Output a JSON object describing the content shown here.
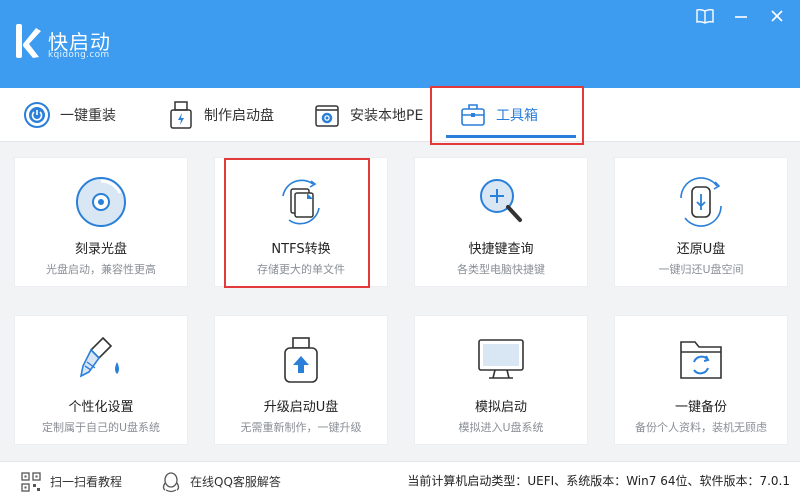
{
  "app": {
    "title": "快启动",
    "url": "kqidong.com"
  },
  "tabs": [
    {
      "label": "一键重装",
      "icon": "power-icon"
    },
    {
      "label": "制作启动盘",
      "icon": "usb-drive-icon"
    },
    {
      "label": "安装本地PE",
      "icon": "gear-box-icon"
    },
    {
      "label": "工具箱",
      "icon": "toolbox-icon",
      "active": true
    }
  ],
  "tools": [
    {
      "title": "刻录光盘",
      "sub": "光盘启动，兼容性更高",
      "icon": "disc-icon"
    },
    {
      "title": "NTFS转换",
      "sub": "存储更大的单文件",
      "icon": "file-convert-icon"
    },
    {
      "title": "快捷键查询",
      "sub": "各类型电脑快捷键",
      "icon": "magnifier-icon"
    },
    {
      "title": "还原U盘",
      "sub": "一键归还U盘空间",
      "icon": "usb-restore-icon"
    },
    {
      "title": "个性化设置",
      "sub": "定制属于自己的U盘系统",
      "icon": "paint-brush-icon"
    },
    {
      "title": "升级启动U盘",
      "sub": "无需重新制作，一键升级",
      "icon": "usb-upgrade-icon"
    },
    {
      "title": "模拟启动",
      "sub": "模拟进入U盘系统",
      "icon": "monitor-icon"
    },
    {
      "title": "一键备份",
      "sub": "备份个人资料，装机无顾虑",
      "icon": "folder-backup-icon"
    }
  ],
  "footer": {
    "qr_label": "扫一扫看教程",
    "qq_label": "在线QQ客服解答",
    "status": "当前计算机启动类型：UEFI、系统版本：Win7 64位、软件版本：7.0.1"
  },
  "colors": {
    "header": "#3d9bf0",
    "accent": "#2a7fd9",
    "highlight": "#e23a3a"
  }
}
